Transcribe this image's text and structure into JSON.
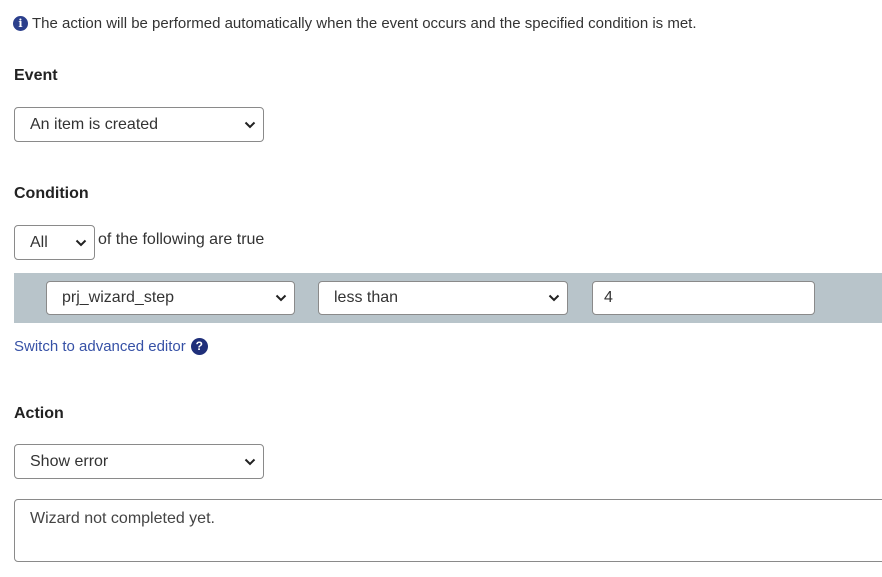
{
  "info": {
    "text": "The action will be performed automatically when the event occurs and the specified condition is met.",
    "icon": "info-icon"
  },
  "event": {
    "label": "Event",
    "selected": "An item is created"
  },
  "condition": {
    "label": "Condition",
    "quantifier": "All",
    "following_text": "of the following are true",
    "field": "prj_wizard_step",
    "operator": "less than",
    "value": "4"
  },
  "advanced_link": {
    "label": "Switch to advanced editor",
    "icon": "help-icon"
  },
  "action": {
    "label": "Action",
    "selected": "Show error",
    "message": "Wizard not completed yet."
  },
  "colors": {
    "link": "#3651a6",
    "condition_row_bg": "#b8c4ca",
    "icon_blue": "#2b3f8c"
  }
}
